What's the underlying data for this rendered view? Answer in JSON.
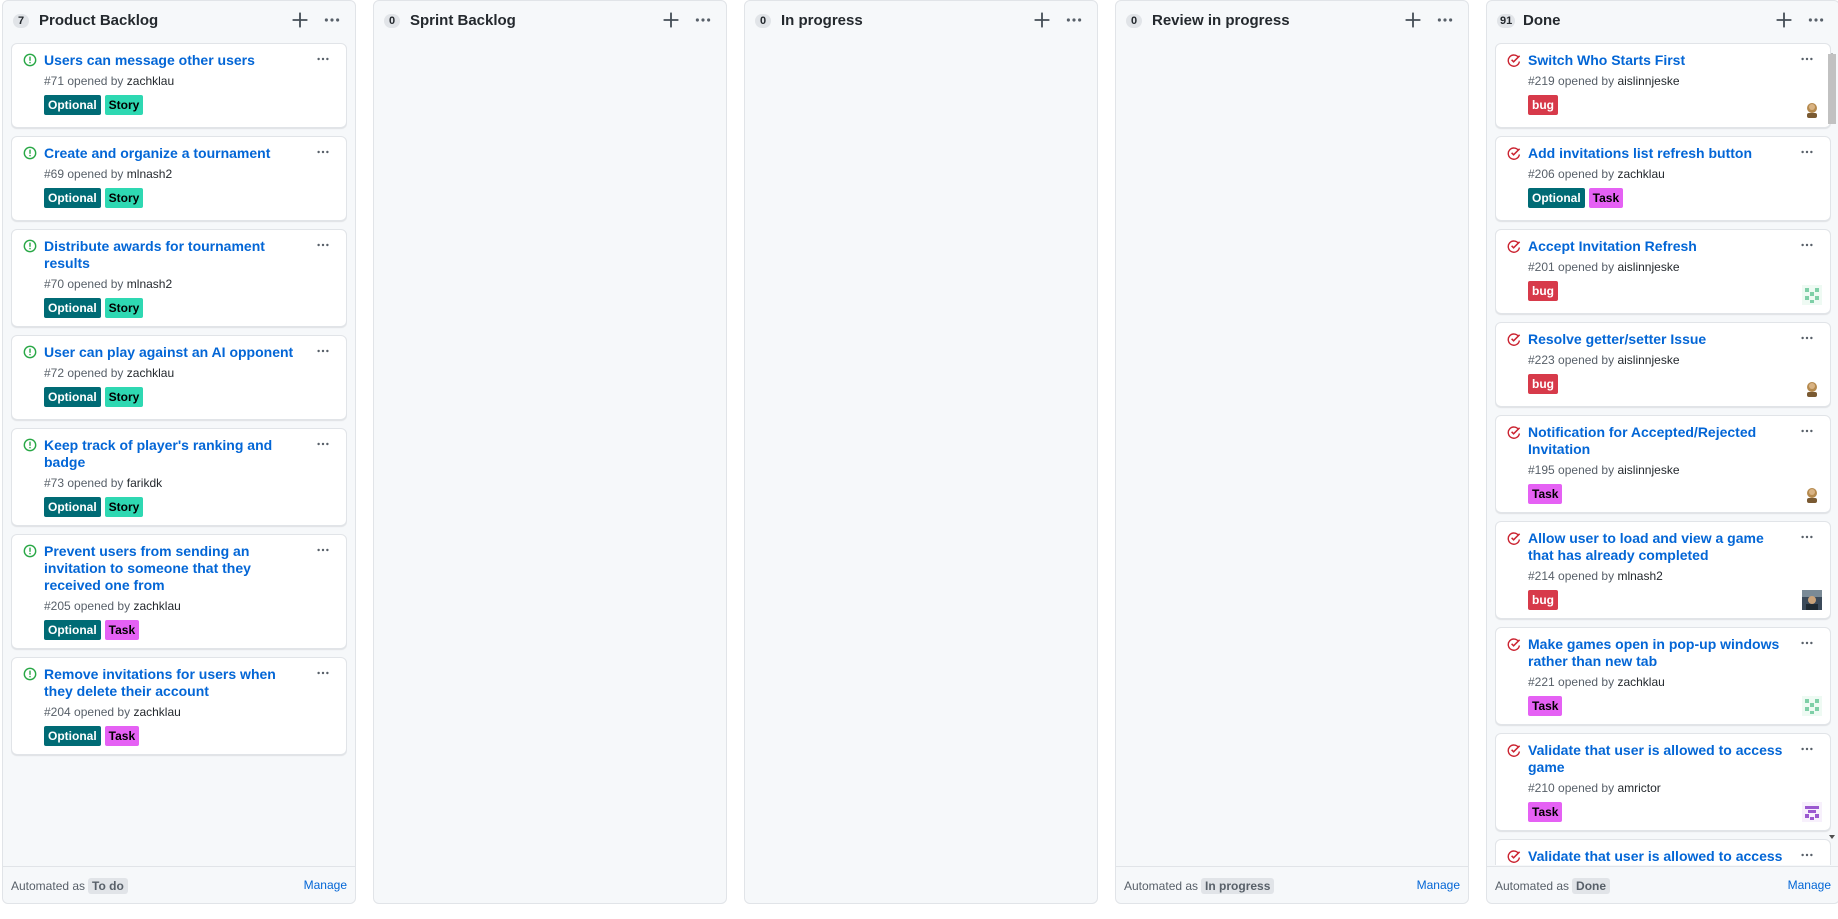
{
  "colors": {
    "link": "#0366d6",
    "open_icon": "#28a745",
    "closed_icon": "#cb2431",
    "optional": "#006b75",
    "story": "#2ed8b2",
    "task": "#e561f4",
    "bug": "#d73a4a"
  },
  "columns": [
    {
      "count": "7",
      "title": "Product Backlog",
      "automation": {
        "prefix": "Automated as",
        "value": "To do",
        "manage": "Manage"
      },
      "cards": [
        {
          "state": "open",
          "title": "Users can message other users",
          "number": "#71",
          "opened_by": "opened by",
          "author": "zachklau",
          "labels": [
            {
              "text": "Optional",
              "bg": "#006b75",
              "fg": "#ffffff"
            },
            {
              "text": "Story",
              "bg": "#2ed8b2",
              "fg": "#000000"
            }
          ]
        },
        {
          "state": "open",
          "title": "Create and organize a tournament",
          "number": "#69",
          "opened_by": "opened by",
          "author": "mlnash2",
          "labels": [
            {
              "text": "Optional",
              "bg": "#006b75",
              "fg": "#ffffff"
            },
            {
              "text": "Story",
              "bg": "#2ed8b2",
              "fg": "#000000"
            }
          ]
        },
        {
          "state": "open",
          "title": "Distribute awards for tournament results",
          "number": "#70",
          "opened_by": "opened by",
          "author": "mlnash2",
          "labels": [
            {
              "text": "Optional",
              "bg": "#006b75",
              "fg": "#ffffff"
            },
            {
              "text": "Story",
              "bg": "#2ed8b2",
              "fg": "#000000"
            }
          ]
        },
        {
          "state": "open",
          "title": "User can play against an AI opponent",
          "number": "#72",
          "opened_by": "opened by",
          "author": "zachklau",
          "labels": [
            {
              "text": "Optional",
              "bg": "#006b75",
              "fg": "#ffffff"
            },
            {
              "text": "Story",
              "bg": "#2ed8b2",
              "fg": "#000000"
            }
          ]
        },
        {
          "state": "open",
          "title": "Keep track of player's ranking and badge",
          "number": "#73",
          "opened_by": "opened by",
          "author": "farikdk",
          "labels": [
            {
              "text": "Optional",
              "bg": "#006b75",
              "fg": "#ffffff"
            },
            {
              "text": "Story",
              "bg": "#2ed8b2",
              "fg": "#000000"
            }
          ]
        },
        {
          "state": "open",
          "title": "Prevent users from sending an invitation to someone that they received one from",
          "number": "#205",
          "opened_by": "opened by",
          "author": "zachklau",
          "labels": [
            {
              "text": "Optional",
              "bg": "#006b75",
              "fg": "#ffffff"
            },
            {
              "text": "Task",
              "bg": "#e561f4",
              "fg": "#000000"
            }
          ]
        },
        {
          "state": "open",
          "title": "Remove invitations for users when they delete their account",
          "number": "#204",
          "opened_by": "opened by",
          "author": "zachklau",
          "labels": [
            {
              "text": "Optional",
              "bg": "#006b75",
              "fg": "#ffffff"
            },
            {
              "text": "Task",
              "bg": "#e561f4",
              "fg": "#000000"
            }
          ]
        }
      ]
    },
    {
      "count": "0",
      "title": "Sprint Backlog",
      "automation": null,
      "cards": []
    },
    {
      "count": "0",
      "title": "In progress",
      "automation": null,
      "cards": []
    },
    {
      "count": "0",
      "title": "Review in progress",
      "automation": {
        "prefix": "Automated as",
        "value": "In progress",
        "manage": "Manage"
      },
      "cards": []
    },
    {
      "count": "91",
      "title": "Done",
      "automation": {
        "prefix": "Automated as",
        "value": "Done",
        "manage": "Manage"
      },
      "cards": [
        {
          "state": "closed",
          "title": "Switch Who Starts First",
          "number": "#219",
          "opened_by": "opened by",
          "author": "aislinnjeske",
          "avatar": "brown",
          "labels": [
            {
              "text": "bug",
              "bg": "#d73a4a",
              "fg": "#ffffff"
            }
          ]
        },
        {
          "state": "closed",
          "title": "Add invitations list refresh button",
          "number": "#206",
          "opened_by": "opened by",
          "author": "zachklau",
          "labels": [
            {
              "text": "Optional",
              "bg": "#006b75",
              "fg": "#ffffff"
            },
            {
              "text": "Task",
              "bg": "#e561f4",
              "fg": "#000000"
            }
          ]
        },
        {
          "state": "closed",
          "title": "Accept Invitation Refresh",
          "number": "#201",
          "opened_by": "opened by",
          "author": "aislinnjeske",
          "avatar": "green",
          "labels": [
            {
              "text": "bug",
              "bg": "#d73a4a",
              "fg": "#ffffff"
            }
          ]
        },
        {
          "state": "closed",
          "title": "Resolve getter/setter Issue",
          "number": "#223",
          "opened_by": "opened by",
          "author": "aislinnjeske",
          "avatar": "brown",
          "labels": [
            {
              "text": "bug",
              "bg": "#d73a4a",
              "fg": "#ffffff"
            }
          ]
        },
        {
          "state": "closed",
          "title": "Notification for Accepted/Rejected Invitation",
          "number": "#195",
          "opened_by": "opened by",
          "author": "aislinnjeske",
          "avatar": "brown",
          "labels": [
            {
              "text": "Task",
              "bg": "#e561f4",
              "fg": "#000000"
            }
          ]
        },
        {
          "state": "closed",
          "title": "Allow user to load and view a game that has already completed",
          "number": "#214",
          "opened_by": "opened by",
          "author": "mlnash2",
          "avatar": "photo",
          "labels": [
            {
              "text": "bug",
              "bg": "#d73a4a",
              "fg": "#ffffff"
            }
          ]
        },
        {
          "state": "closed",
          "title": "Make games open in pop-up windows rather than new tab",
          "number": "#221",
          "opened_by": "opened by",
          "author": "zachklau",
          "avatar": "green",
          "labels": [
            {
              "text": "Task",
              "bg": "#e561f4",
              "fg": "#000000"
            }
          ]
        },
        {
          "state": "closed",
          "title": "Validate that user is allowed to access game",
          "number": "#210",
          "opened_by": "opened by",
          "author": "amrictor",
          "avatar": "purple",
          "labels": [
            {
              "text": "Task",
              "bg": "#e561f4",
              "fg": "#000000"
            }
          ]
        },
        {
          "state": "closed",
          "title": "Validate that user is allowed to access game",
          "number": "",
          "opened_by": "",
          "author": "",
          "labels": []
        }
      ]
    }
  ]
}
